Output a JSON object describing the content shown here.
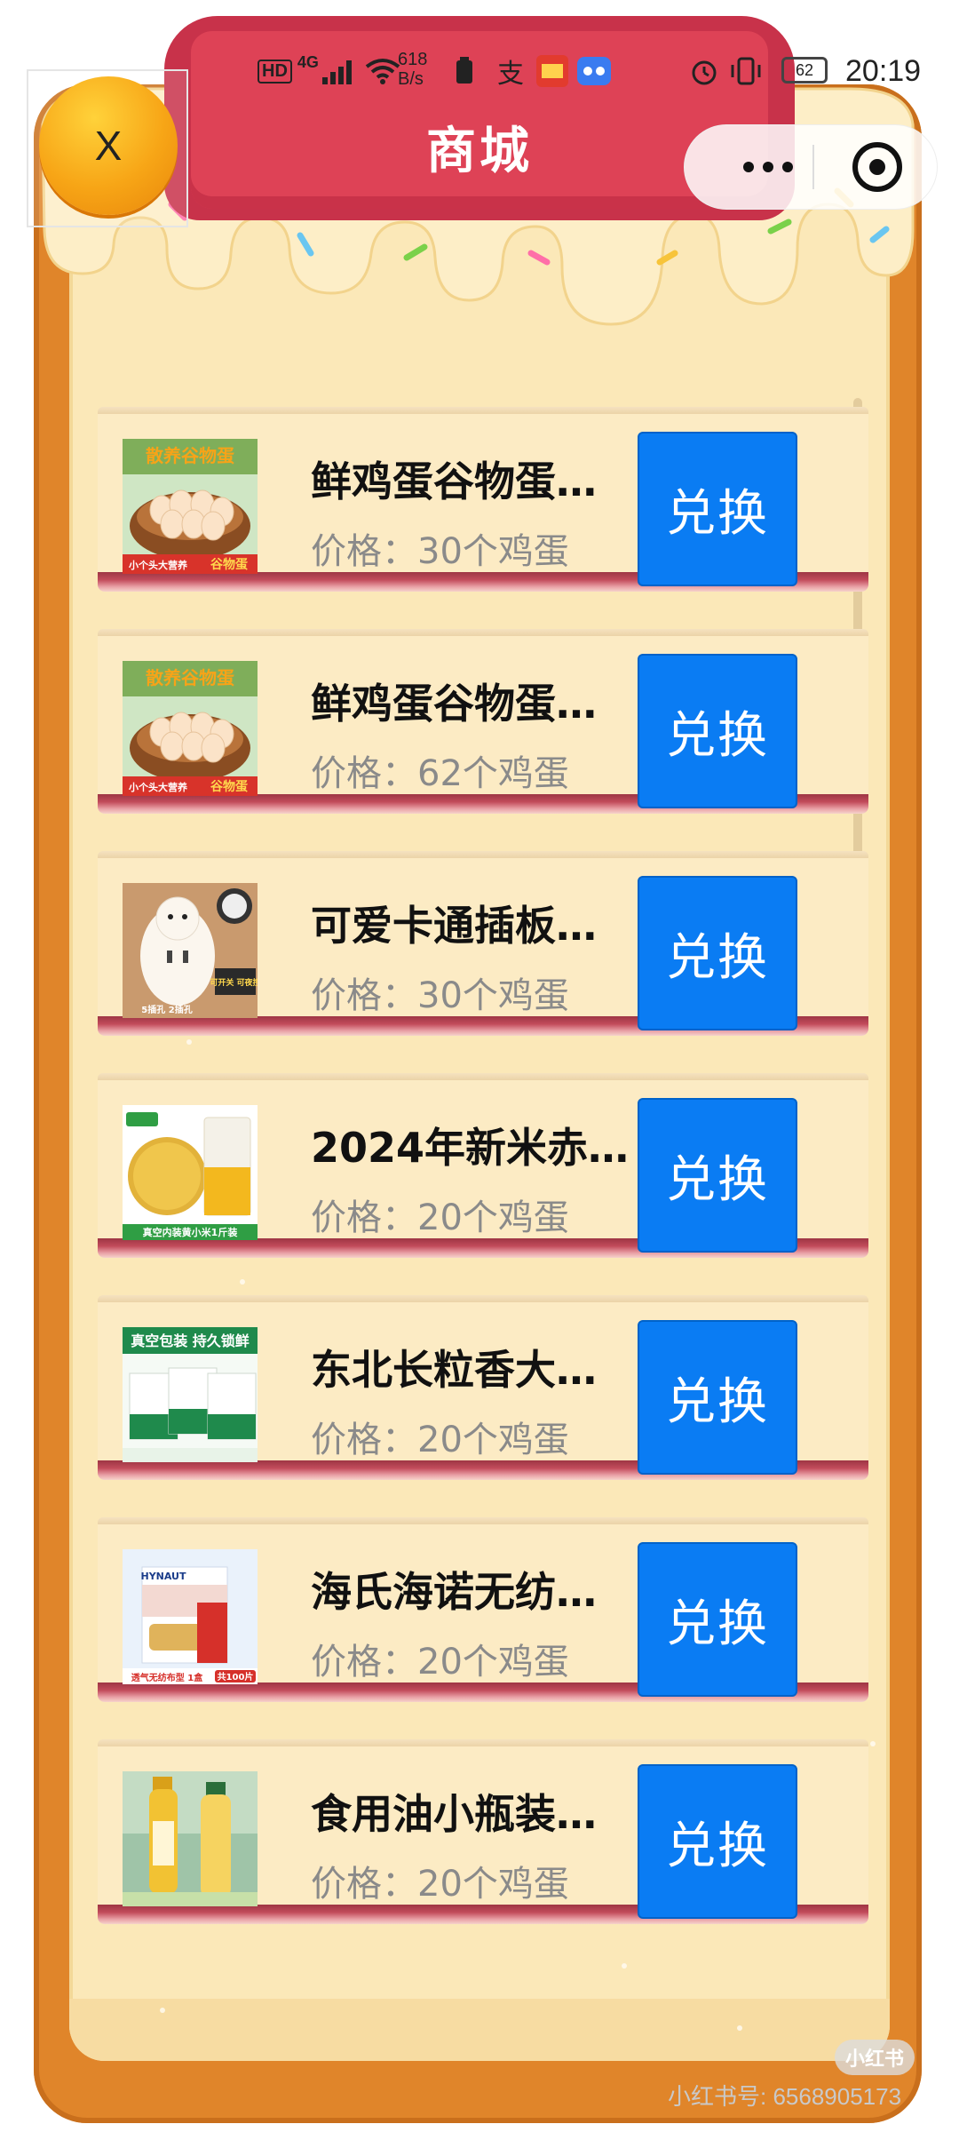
{
  "header": {
    "title": "商城",
    "close_label": "X"
  },
  "status_bar": {
    "network_badge": "HD",
    "signal_label": "4G",
    "speed_value": "618",
    "speed_unit": "B/s",
    "battery": "62",
    "time": "20:19"
  },
  "products": [
    {
      "name": "鲜鸡蛋谷物蛋…",
      "price": "价格：30个鸡蛋",
      "button": "兑换",
      "thumb": "egg",
      "thumb_top": "散养谷物蛋",
      "thumb_bottom": "小个头大营养",
      "thumb_badge": "谷物蛋"
    },
    {
      "name": "鲜鸡蛋谷物蛋…",
      "price": "价格：62个鸡蛋",
      "button": "兑换",
      "thumb": "egg",
      "thumb_top": "散养谷物蛋",
      "thumb_bottom": "小个头大营养",
      "thumb_badge": "谷物蛋"
    },
    {
      "name": "可爱卡通插板…",
      "price": "价格：30个鸡蛋",
      "button": "兑换",
      "thumb": "plug",
      "thumb_top": "",
      "thumb_bottom": "5插孔 2插孔",
      "thumb_badge": "可开关 可夜控"
    },
    {
      "name": "2024年新米赤…",
      "price": "价格：20个鸡蛋",
      "button": "兑换",
      "thumb": "millet",
      "thumb_top": "",
      "thumb_bottom": "真空内装黄小米1斤装",
      "thumb_badge": ""
    },
    {
      "name": "东北长粒香大…",
      "price": "价格：20个鸡蛋",
      "button": "兑换",
      "thumb": "rice",
      "thumb_top": "真空包装 持久锁鲜",
      "thumb_bottom": "",
      "thumb_badge": ""
    },
    {
      "name": "海氏海诺无纺…",
      "price": "价格：20个鸡蛋",
      "button": "兑换",
      "thumb": "bandage",
      "thumb_top": "HYNAUT",
      "thumb_bottom": "透气无纺布型 1盒",
      "thumb_badge": "共100片"
    },
    {
      "name": "食用油小瓶装…",
      "price": "价格：20个鸡蛋",
      "button": "兑换",
      "thumb": "oil",
      "thumb_top": "",
      "thumb_bottom": "",
      "thumb_badge": ""
    }
  ],
  "watermark": {
    "logo": "小红书",
    "text": "小红书号: 6568905173"
  },
  "colors": {
    "frame": "#e0852a",
    "inner": "#fbe8b8",
    "ribbon": "#de4256",
    "button": "#0a7cf3"
  }
}
